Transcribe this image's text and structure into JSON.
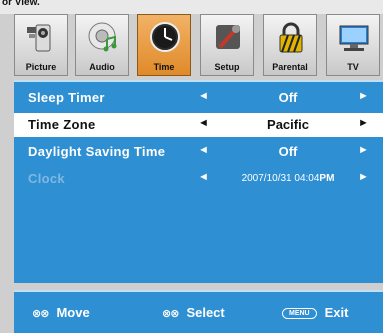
{
  "top_text": "or View.",
  "tabs": [
    {
      "label": "Picture",
      "icon": "picture-icon",
      "active": false
    },
    {
      "label": "Audio",
      "icon": "audio-icon",
      "active": false
    },
    {
      "label": "Time",
      "icon": "clock-icon",
      "active": true
    },
    {
      "label": "Setup",
      "icon": "setup-icon",
      "active": false
    },
    {
      "label": "Parental",
      "icon": "lock-icon",
      "active": false
    },
    {
      "label": "TV",
      "icon": "tv-icon",
      "active": false
    }
  ],
  "menu": {
    "rows": [
      {
        "label": "Sleep Timer",
        "value": "Off",
        "left_arrow": "◄",
        "right_arrow": "►"
      },
      {
        "label": "Time Zone",
        "value": "Pacific",
        "left_arrow": "◄",
        "right_arrow": "►"
      },
      {
        "label": "Daylight Saving Time",
        "value": "Off",
        "left_arrow": "◄",
        "right_arrow": "►"
      },
      {
        "label": "Clock",
        "value": "2007/10/31 04:04",
        "value_suffix": "PM",
        "left_arrow": "◄",
        "right_arrow": "►"
      }
    ]
  },
  "footer": {
    "move_glyph": "⊗⊗",
    "move_label": "Move",
    "select_glyph": "⊗⊗",
    "select_label": "Select",
    "menu_key": "MENU",
    "exit_label": "Exit"
  },
  "colors": {
    "panel": "#2e8fd2",
    "active_tab": "#e08a2a",
    "selected_row": "#ffffff"
  }
}
